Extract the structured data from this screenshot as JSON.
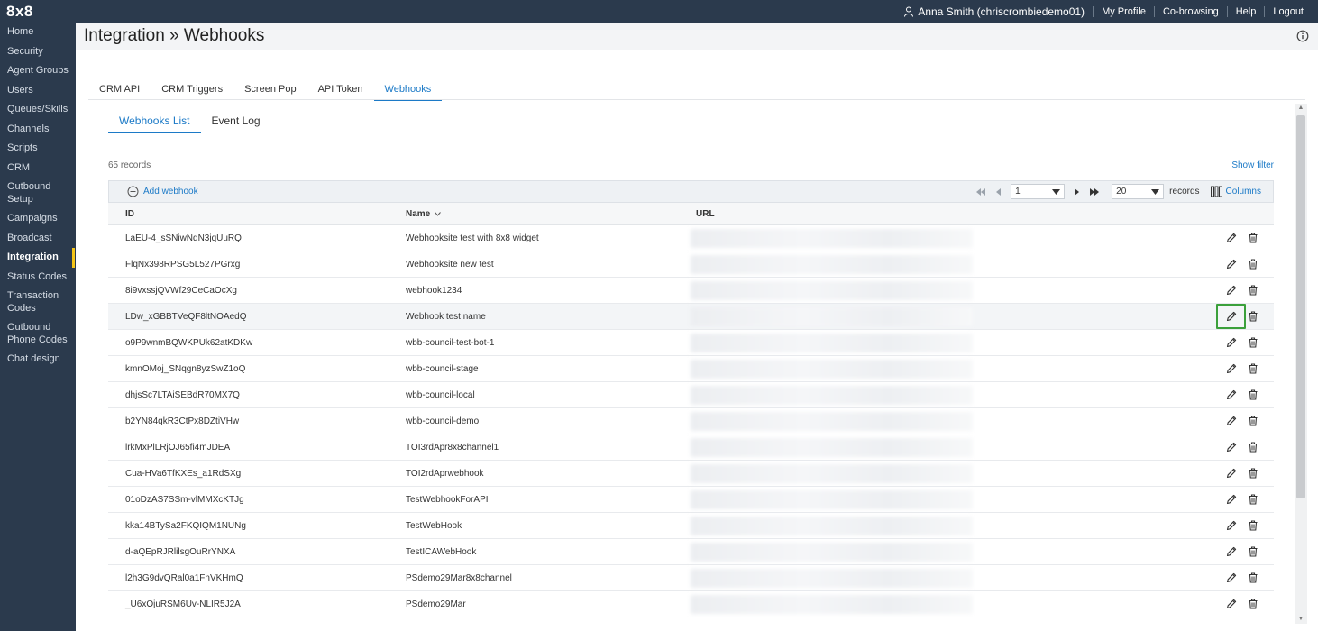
{
  "app": {
    "logo": "8x8"
  },
  "topbar": {
    "user": "Anna Smith (chriscrombiedemo01)",
    "links": [
      "My Profile",
      "Co-browsing",
      "Help",
      "Logout"
    ]
  },
  "sidebar": {
    "items": [
      {
        "label": "Home"
      },
      {
        "label": "Security"
      },
      {
        "label": "Agent Groups"
      },
      {
        "label": "Users"
      },
      {
        "label": "Queues/Skills"
      },
      {
        "label": "Channels"
      },
      {
        "label": "Scripts"
      },
      {
        "label": "CRM"
      },
      {
        "label": "Outbound Setup"
      },
      {
        "label": "Campaigns"
      },
      {
        "label": "Broadcast"
      },
      {
        "label": "Integration",
        "active": true
      },
      {
        "label": "Status Codes"
      },
      {
        "label": "Transaction Codes"
      },
      {
        "label": "Outbound Phone Codes"
      },
      {
        "label": "Chat design"
      }
    ]
  },
  "page": {
    "title": "Integration » Webhooks"
  },
  "tabs": [
    "CRM API",
    "CRM Triggers",
    "Screen Pop",
    "API Token",
    "Webhooks"
  ],
  "subtabs": [
    "Webhooks List",
    "Event Log"
  ],
  "records_label": "65 records",
  "show_filter": "Show filter",
  "toolbar": {
    "add_label": "Add webhook",
    "page_value": "1",
    "page_size": "20",
    "records_label": "records",
    "columns_label": "Columns"
  },
  "grid": {
    "headers": {
      "id": "ID",
      "name": "Name",
      "url": "URL"
    },
    "rows": [
      {
        "id": "LaEU-4_sSNiwNqN3jqUuRQ",
        "name": "Webhooksite test with 8x8 widget"
      },
      {
        "id": "FlqNx398RPSG5L527PGrxg",
        "name": "Webhooksite new test"
      },
      {
        "id": "8i9vxssjQVWf29CeCaOcXg",
        "name": "webhook1234"
      },
      {
        "id": "LDw_xGBBTVeQF8ltNOAedQ",
        "name": "Webhook test name"
      },
      {
        "id": "o9P9wnmBQWKPUk62atKDKw",
        "name": "wbb-council-test-bot-1"
      },
      {
        "id": "kmnOMoj_SNqgn8yzSwZ1oQ",
        "name": "wbb-council-stage"
      },
      {
        "id": "dhjsSc7LTAiSEBdR70MX7Q",
        "name": "wbb-council-local"
      },
      {
        "id": "b2YN84qkR3CtPx8DZtiVHw",
        "name": "wbb-council-demo"
      },
      {
        "id": "lrkMxPlLRjOJ65fi4mJDEA",
        "name": "TOI3rdApr8x8channel1"
      },
      {
        "id": "Cua-HVa6TfKXEs_a1RdSXg",
        "name": "TOI2rdAprwebhook"
      },
      {
        "id": "01oDzAS7SSm-vlMMXcKTJg",
        "name": "TestWebhookForAPI"
      },
      {
        "id": "kka14BTySa2FKQIQM1NUNg",
        "name": "TestWebHook"
      },
      {
        "id": "d-aQEpRJRlilsgOuRrYNXA",
        "name": "TestICAWebHook"
      },
      {
        "id": "l2h3G9dvQRal0a1FnVKHmQ",
        "name": "PSdemo29Mar8x8channel"
      },
      {
        "id": "_U6xOjuRSM6Uv-NLIR5J2A",
        "name": "PSdemo29Mar"
      }
    ]
  },
  "icons": {
    "edit": "pencil-icon",
    "delete": "trash-icon",
    "add": "plus-circle-icon",
    "columns": "columns-icon",
    "info": "info-icon"
  },
  "colors": {
    "sidebar": "#2b3a4d",
    "accent": "#1c7ac7",
    "active_marker": "#f5c518",
    "highlight_box": "#3ba03b"
  }
}
